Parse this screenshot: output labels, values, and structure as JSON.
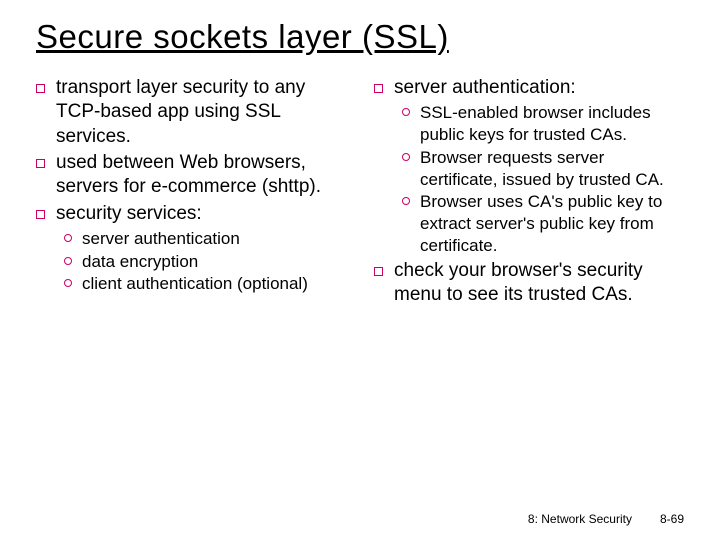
{
  "title": "Secure sockets layer (SSL)",
  "left": {
    "b1": "transport layer security to any TCP-based app using SSL services.",
    "b2": "used between Web browsers, servers for e-commerce (shttp).",
    "b3": "security services:",
    "b3s1": "server authentication",
    "b3s2": "data encryption",
    "b3s3": "client authentication (optional)"
  },
  "right": {
    "b1": "server authentication:",
    "b1s1": "SSL-enabled browser includes public keys for trusted CAs.",
    "b1s2": "Browser requests server certificate, issued by trusted CA.",
    "b1s3": "Browser uses CA's public key to extract server's public key from certificate.",
    "b2": "check your browser's security menu to see its trusted CAs."
  },
  "footer": {
    "section": "8: Network Security",
    "page": "8-69"
  }
}
